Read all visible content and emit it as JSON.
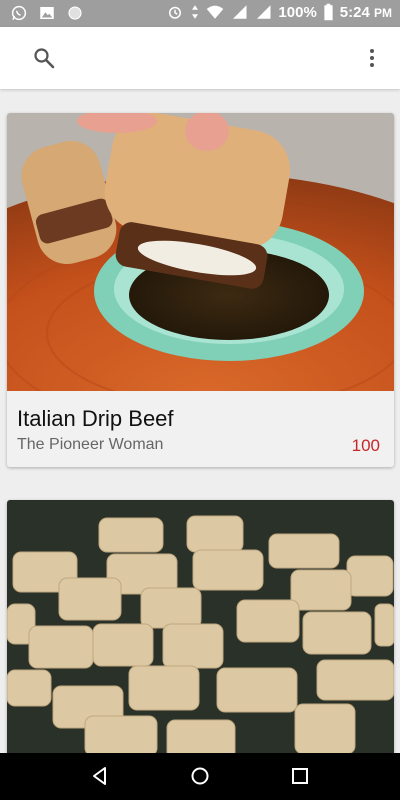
{
  "status_bar": {
    "battery_percent": "100%",
    "time": "5:24",
    "ampm": "PM",
    "left_icons": [
      "whatsapp-icon",
      "gallery-icon",
      "circle-icon"
    ],
    "right_icons": [
      "alarm-icon",
      "data-arrows-icon",
      "wifi-icon",
      "signal-4g-icon",
      "signal-3g-icon",
      "battery-icon"
    ]
  },
  "app_bar": {
    "search_icon": "search-icon",
    "menu_icon": "more-vert-icon"
  },
  "recipes": [
    {
      "title": "Italian Drip Beef",
      "source": "The Pioneer Woman",
      "score": "100"
    },
    {
      "title": "",
      "source": "",
      "score": ""
    }
  ],
  "nav_bar": {
    "icons": [
      "back-icon",
      "home-icon",
      "recents-icon"
    ]
  },
  "colors": {
    "status_bar": "#9e9e9e",
    "app_bar": "#ffffff",
    "background": "#eeeeee",
    "card": "#f1f1f1",
    "score": "#c62828",
    "nav_bar": "#000000"
  }
}
